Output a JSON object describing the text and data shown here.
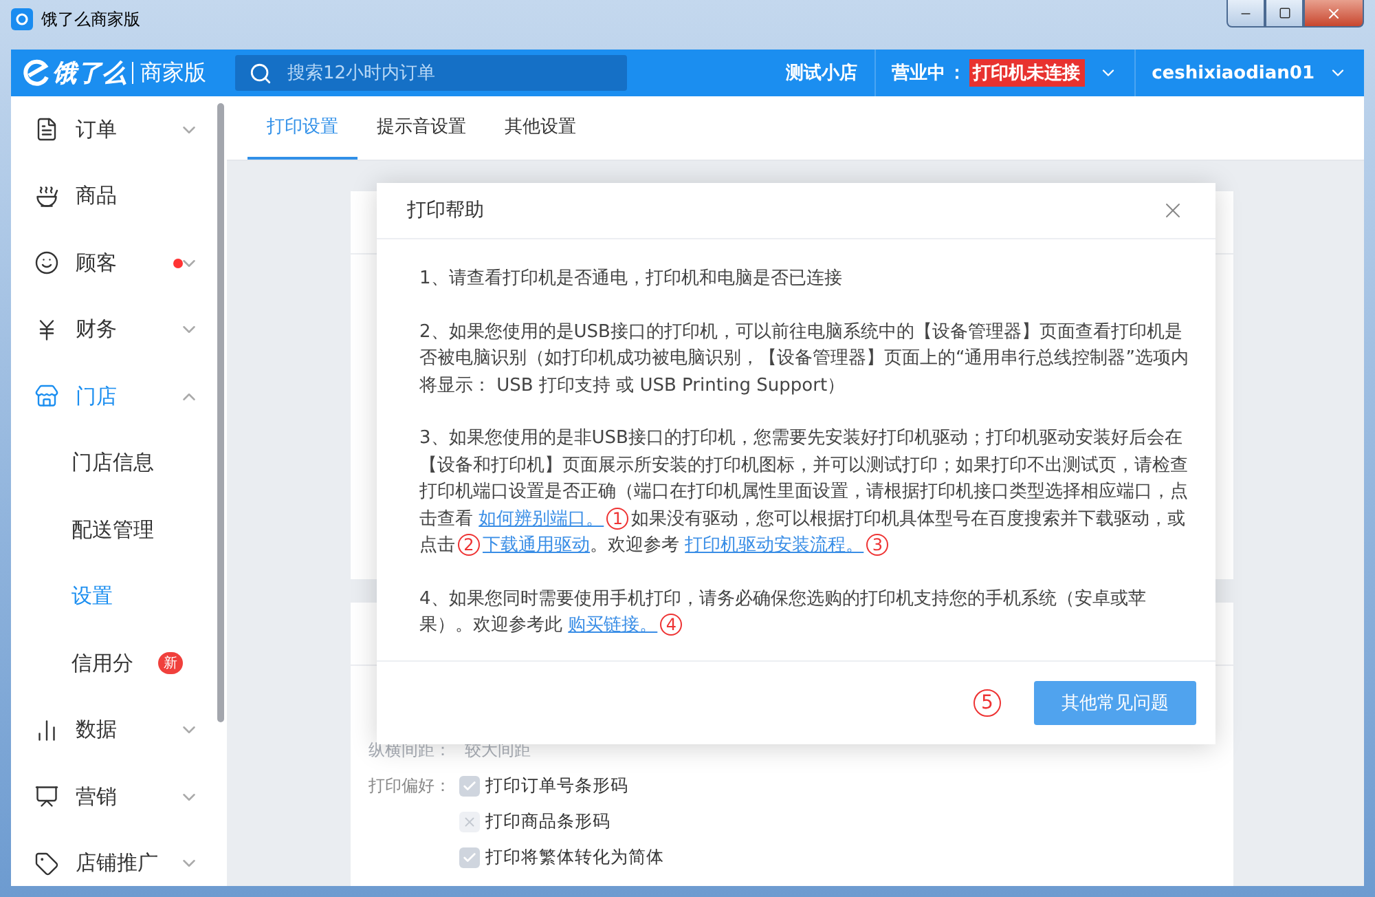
{
  "window": {
    "title": "饿了么商家版"
  },
  "header": {
    "logo": "饿了么",
    "edition": "商家版",
    "search": {
      "placeholder": "搜索12小时内订单"
    },
    "shop": "测试小店",
    "status": "营业中",
    "separator": "：",
    "printer_badge": "打印机未连接",
    "account": "ceshixiaodian01"
  },
  "sidebar": {
    "items": [
      {
        "label": "订单",
        "expanded": false,
        "dot": false
      },
      {
        "label": "商品"
      },
      {
        "label": "顾客",
        "expanded": false,
        "dot": true
      },
      {
        "label": "财务",
        "expanded": false,
        "dot": false
      },
      {
        "label": "门店",
        "expanded": true,
        "dot": false,
        "children": [
          {
            "label": "门店信息",
            "selected": false
          },
          {
            "label": "配送管理",
            "selected": false
          },
          {
            "label": "设置",
            "selected": true
          },
          {
            "label": "信用分",
            "selected": false,
            "badge": "新"
          }
        ]
      },
      {
        "label": "数据",
        "expanded": false,
        "dot": false
      },
      {
        "label": "营销",
        "expanded": false,
        "dot": false
      },
      {
        "label": "店铺推广",
        "expanded": false,
        "dot": false
      }
    ]
  },
  "tabs": [
    {
      "label": "打印设置",
      "selected": true
    },
    {
      "label": "提示音设置",
      "selected": false
    },
    {
      "label": "其他设置",
      "selected": false
    }
  ],
  "settings": {
    "faded_label": "纵横间距：",
    "faded_value": "较大间距",
    "preference_label": "打印偏好：",
    "options": [
      {
        "label": "打印订单号条形码",
        "checked": true
      },
      {
        "label": "打印商品条形码",
        "checked": false
      },
      {
        "label": "打印将繁体转化为简体",
        "checked": true
      }
    ]
  },
  "dialog": {
    "title": "打印帮助",
    "paragraphs": [
      [
        {
          "kind": "text",
          "text": "1、请查看打印机是否通电，打印机和电脑是否已连接"
        }
      ],
      [
        {
          "kind": "text",
          "text": "2、如果您使用的是USB接口的打印机，可以前往电脑系统中的【设备管理器】页面查看打印机是否被电脑识别（如打印机成功被电脑识别，【设备管理器】页面上的“通用串行总线控制器”选项内将显示： USB 打印支持 或 USB Printing Support）"
        }
      ],
      [
        {
          "kind": "text",
          "text": "3、如果您使用的是非USB接口的打印机，您需要先安装好打印机驱动；打印机驱动安装好后会在【设备和打印机】页面展示所安装的打印机图标，并可以测试打印；如果打印不出测试页，请检查打印机端口设置是否正确（端口在打印机属性里面设置，请根据打印机接口类型选择相应端口，点击查看 "
        },
        {
          "kind": "link",
          "text": "如何辨别端口。"
        },
        {
          "kind": "marker",
          "text": "1"
        },
        {
          "kind": "text",
          "text": "如果没有驱动，您可以根据打印机具体型号在百度搜索并下载驱动，或点击"
        },
        {
          "kind": "marker",
          "text": "2"
        },
        {
          "kind": "link",
          "text": "下载通用驱动"
        },
        {
          "kind": "text",
          "text": "。欢迎参考 "
        },
        {
          "kind": "link",
          "text": "打印机驱动安装流程。"
        },
        {
          "kind": "marker",
          "text": "3"
        }
      ],
      [
        {
          "kind": "text",
          "text": "4、如果您同时需要使用手机打印，请务必确保您选购的打印机支持您的手机系统（安卓或苹果）。欢迎参考此 "
        },
        {
          "kind": "link",
          "text": "购买链接。"
        },
        {
          "kind": "marker",
          "text": "4"
        }
      ]
    ],
    "footer_marker": "5",
    "button": "其他常见问题"
  }
}
